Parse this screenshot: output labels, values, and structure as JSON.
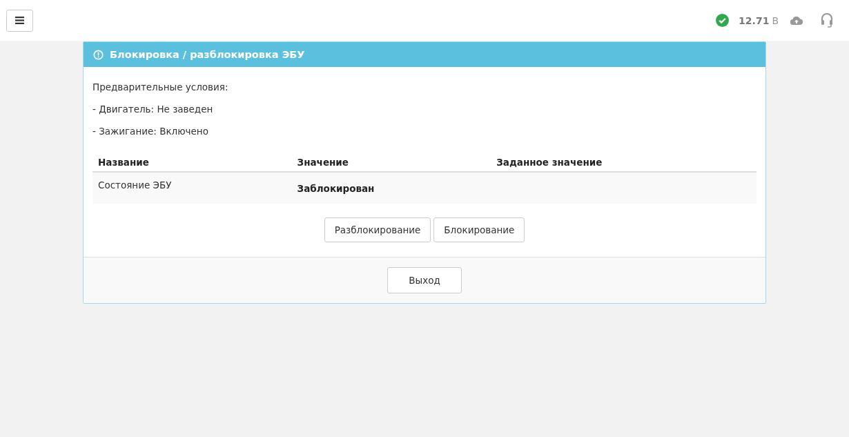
{
  "topbar": {
    "status_ok": true,
    "voltage": "12.71",
    "voltage_unit": "В"
  },
  "dialog": {
    "title": "Блокировка / разблокировка ЭБУ",
    "conditions": [
      "Предварительные условия:",
      "- Двигатель: Не заведен",
      "- Зажигание: Включено"
    ],
    "table": {
      "columns": [
        "Название",
        "Значение",
        "Заданное значение"
      ],
      "rows": [
        {
          "name": "Состояние ЭБУ",
          "value": "Заблокирован"
        }
      ]
    },
    "actions": [
      "Разблокирование",
      "Блокирование"
    ],
    "footer_button": "Выход"
  }
}
